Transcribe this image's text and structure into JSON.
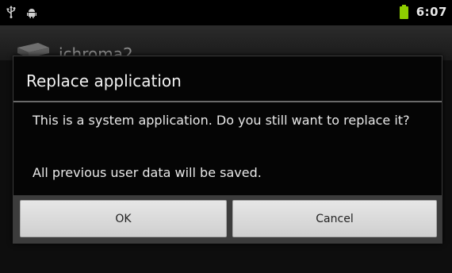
{
  "status_bar": {
    "time": "6:07",
    "left_icons": [
      "usb-icon",
      "android-debug-icon"
    ],
    "battery_color": "#8fce00"
  },
  "background_app": {
    "title": "ichroma2",
    "icon": "package-icon"
  },
  "dialog": {
    "title": "Replace application",
    "message": "This is a system application. Do you still want to replace it?",
    "note": "All previous user data will be saved.",
    "buttons": {
      "ok": "OK",
      "cancel": "Cancel"
    }
  }
}
